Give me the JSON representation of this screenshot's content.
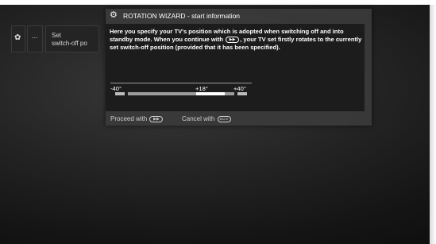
{
  "menu": {
    "gear_icon": "gear-icon",
    "dots_label": "...",
    "set_label_line1": "Set",
    "set_label_line2": "switch-off po"
  },
  "dialog": {
    "icon": "gears-icon",
    "title": "ROTATION WIZARD - start information",
    "body_part1": "Here you specify your TV's position which is adopted when switching off and into standby mode.  When you continue with",
    "body_part2": ", your TV set firstly rotates to the currently set switch-off position (provided that it has been specified).",
    "continue_button_glyph": "▶▶",
    "scale": {
      "min_label": "-40°",
      "mid_label": "+18°",
      "max_label": "+40°",
      "min_value": -40,
      "max_value": 40,
      "current_value": 18
    },
    "footer": {
      "proceed_label": "Proceed with",
      "proceed_glyph": "▶▶",
      "cancel_label": "Cancel with",
      "cancel_glyph": "BACK"
    }
  }
}
